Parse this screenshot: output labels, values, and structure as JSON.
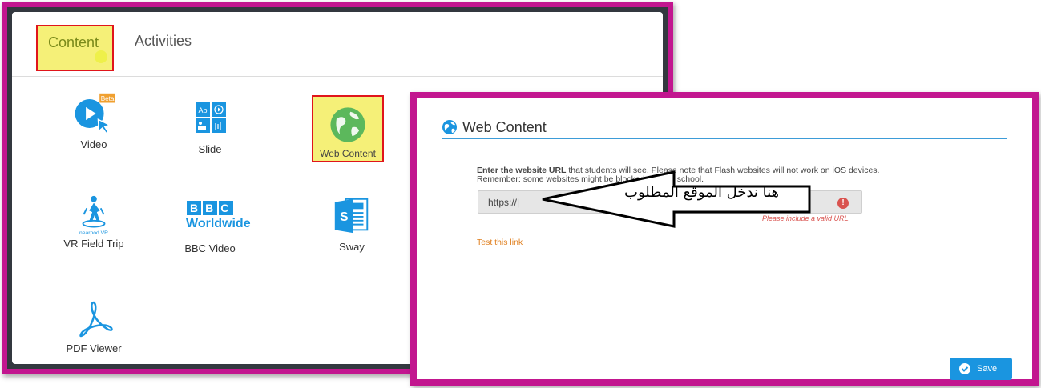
{
  "tabs": {
    "content": "Content",
    "activities": "Activities"
  },
  "tiles": [
    {
      "label": "Video",
      "badge": "Beta"
    },
    {
      "label": "Slide"
    },
    {
      "label": "Web Content"
    },
    {
      "label": "VR Field Trip",
      "sublabel": "nearpod VR"
    },
    {
      "label": "BBC Video",
      "logo_text": "BBC",
      "logo_sub": "Worldwide"
    },
    {
      "label": "Sway",
      "logo_letter": "S"
    },
    {
      "label": "PDF Viewer"
    }
  ],
  "slide_icon": {
    "ab": "Ab"
  },
  "web_content_dialog": {
    "title": "Web Content",
    "instruction_bold": "Enter the website URL",
    "instruction_rest": " that students will see. Please note that Flash websites will not work on iOS devices.",
    "instruction_line2": "Remember: some websites might be blocked by your school.",
    "url_value": "https://|",
    "error_text": "Please include a valid URL.",
    "test_link": "Test this link",
    "save_label": "Save"
  },
  "annotation": {
    "arabic_text": "هنا ندخل الموقع المطلوب"
  },
  "colors": {
    "frame": "#c2168f",
    "highlight": "#f5f078",
    "highlight_border": "#e0151b",
    "accent_blue": "#1a95e0",
    "link_orange": "#e08020",
    "error_red": "#d9534f",
    "globe_green": "#5cb85c"
  }
}
